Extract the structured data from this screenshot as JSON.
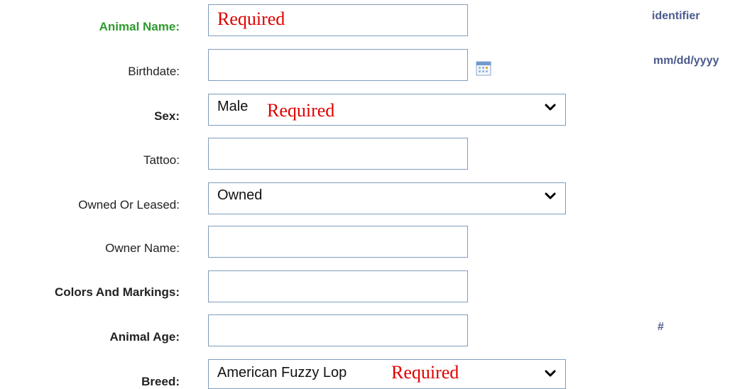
{
  "fields": {
    "animal_name": {
      "label": "Animal Name:",
      "value": "",
      "required_text": "Required",
      "hint": "identifier"
    },
    "birthdate": {
      "label": "Birthdate:",
      "value": "",
      "hint": "mm/dd/yyyy",
      "icon": "calendar-icon"
    },
    "sex": {
      "label": "Sex:",
      "selected": "Male",
      "required_text": "Required"
    },
    "tattoo": {
      "label": "Tattoo:",
      "value": ""
    },
    "owned_or_leased": {
      "label": "Owned Or Leased:",
      "selected": "Owned"
    },
    "owner_name": {
      "label": "Owner Name:",
      "value": ""
    },
    "colors_and_markings": {
      "label": "Colors And Markings:",
      "value": ""
    },
    "animal_age": {
      "label": "Animal Age:",
      "value": "",
      "hint": "#"
    },
    "breed": {
      "label": "Breed:",
      "selected": "American Fuzzy Lop",
      "required_text": "Required"
    }
  },
  "colors": {
    "required_text": "#e00000",
    "required_label": "#2e9a2e",
    "hint": "#4a5a8c",
    "field_border": "#7f9db9"
  }
}
